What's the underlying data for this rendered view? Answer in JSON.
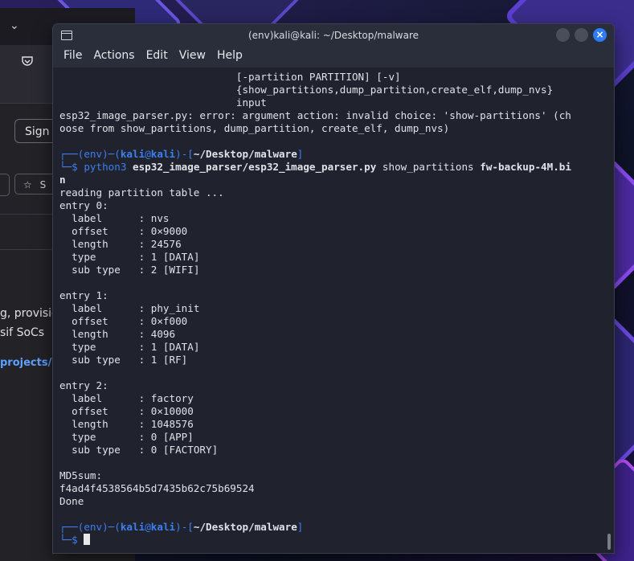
{
  "terminal": {
    "title": "(env)kali@kali: ~/Desktop/malware",
    "menu": [
      "File",
      "Actions",
      "Edit",
      "View",
      "Help"
    ],
    "usage_lines": [
      "[-partition PARTITION] [-v]",
      "{show_partitions,dump_partition,create_elf,dump_nvs}",
      "input"
    ],
    "error_line1": "esp32_image_parser.py: error: argument action: invalid choice: 'show-partitions' (ch",
    "error_line2": "oose from show_partitions, dump_partition, create_elf, dump_nvs)",
    "prompt": {
      "env": "(env)",
      "user": "kali",
      "at": "@",
      "host": "kali",
      "path": "~/Desktop/malware"
    },
    "command": {
      "exe": "python3",
      "script": "esp32_image_parser/esp32_image_parser.py",
      "arg": "show_partitions",
      "file_part1": "fw-backup-4M.bi",
      "file_part2": "n"
    },
    "reading": "reading partition table ...",
    "entries": [
      {
        "header": "entry 0:",
        "label": "nvs",
        "offset": "0×9000",
        "length": "24576",
        "type": "1 [DATA]",
        "sub_type": "2 [WIFI]"
      },
      {
        "header": "entry 1:",
        "label": "phy_init",
        "offset": "0×f000",
        "length": "4096",
        "type": "1 [DATA]",
        "sub_type": "1 [RF]"
      },
      {
        "header": "entry 2:",
        "label": "factory",
        "offset": "0×10000",
        "length": "1048576",
        "type": "0 [APP]",
        "sub_type": "0 [FACTORY]"
      }
    ],
    "field_names": {
      "label": "label",
      "offset": "offset",
      "length": "length",
      "type": "type",
      "sub_type": "sub type"
    },
    "md5_label": "MD5sum:",
    "md5_value": "f4ad4f4538564b5d7435b62c75b69524",
    "done": "Done"
  },
  "browser": {
    "sign_in": "Sign i",
    "star_label": "S",
    "desc_line1": "g, provisio",
    "desc_line2": "sif SoCs",
    "link": "projects/e"
  },
  "colors": {
    "prompt_blue": "#3d7ef0",
    "close_button": "#2f7cf6"
  }
}
